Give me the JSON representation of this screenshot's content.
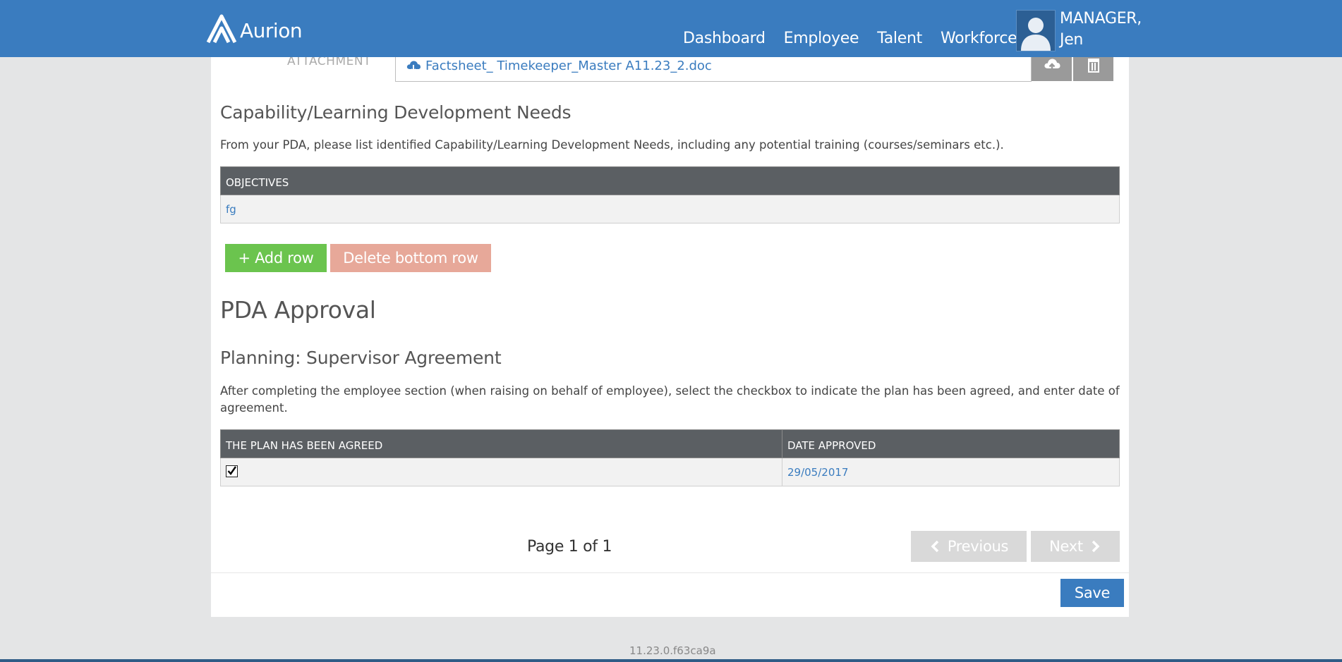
{
  "app": {
    "name": "Aurion"
  },
  "nav": {
    "items": [
      "Dashboard",
      "Employee",
      "Talent",
      "Workforce"
    ]
  },
  "user": {
    "line1": "MANAGER,",
    "line2": "Jen"
  },
  "attachment": {
    "label": "ATTACHMENT",
    "file": "Factsheet_ Timekeeper_Master A11.23_2.doc"
  },
  "capability": {
    "title": "Capability/Learning Development Needs",
    "description": "From your PDA, please list identified Capability/Learning Development Needs, including any potential training (courses/seminars etc.).",
    "table": {
      "header": "OBJECTIVES",
      "rows": [
        "fg"
      ]
    },
    "add_row_label": "+ Add row",
    "delete_row_label": "Delete bottom row"
  },
  "approval": {
    "title": "PDA Approval",
    "subtitle": "Planning: Supervisor Agreement",
    "description": "After completing the employee section (when raising on behalf of employee), select the checkbox to indicate the plan has been agreed, and enter date of agreement.",
    "table": {
      "headers": [
        "THE PLAN HAS BEEN AGREED",
        "DATE APPROVED"
      ],
      "agreed": true,
      "date": "29/05/2017"
    }
  },
  "pager": {
    "text": "Page 1 of 1",
    "previous_label": "Previous",
    "next_label": "Next"
  },
  "save_label": "Save",
  "version": "11.23.0.f63ca9a",
  "colors": {
    "header": "#3a7cbf",
    "add": "#6bc44e",
    "delete": "#e7a899",
    "save": "#3a7cbf",
    "table_header": "#5b5f63"
  }
}
